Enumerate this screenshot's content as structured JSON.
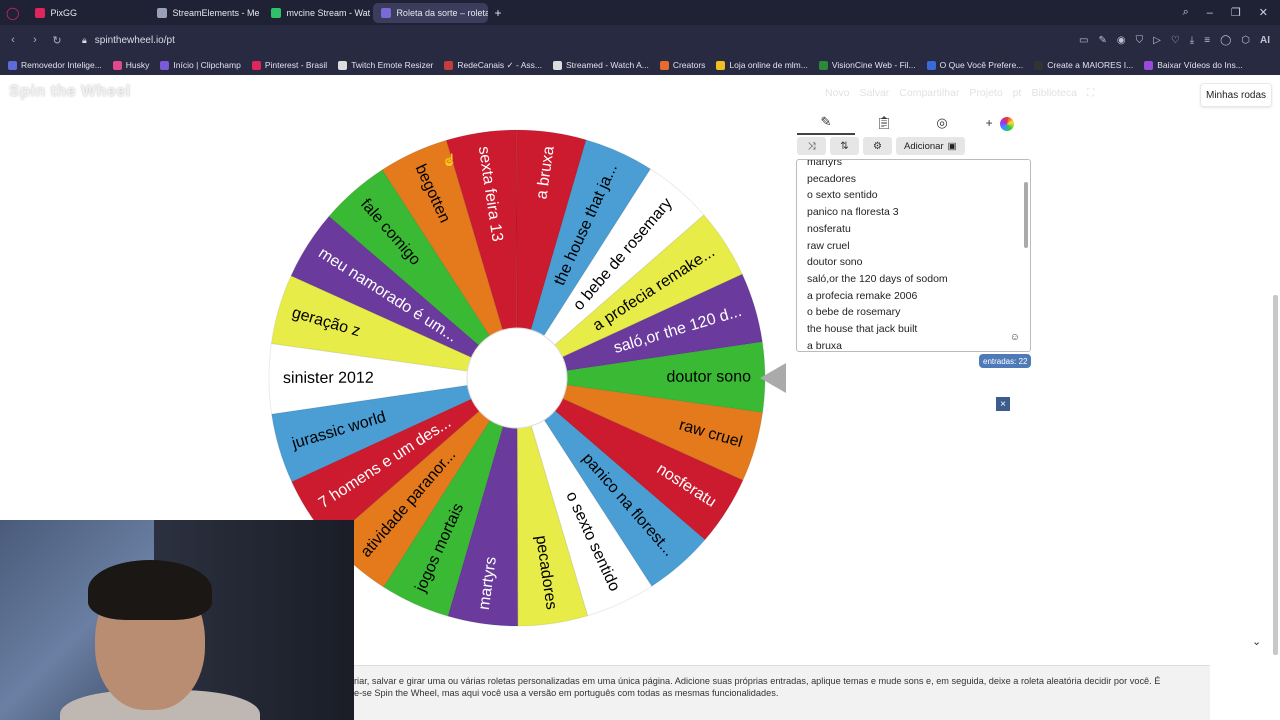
{
  "browser": {
    "tabs": [
      {
        "label": "PixGG",
        "color": "#e0245e",
        "active": false
      },
      {
        "label": "StreamElements - Me",
        "color": "#9aa0b8",
        "active": false
      },
      {
        "label": "mvcine Stream - Wat",
        "color": "#2fc26a",
        "active": false
      },
      {
        "label": "Roleta da sorte – roleta c",
        "color": "#7a6ad8",
        "active": true
      }
    ],
    "new_tab": "+",
    "url": "spinthewheel.io/pt",
    "bookmarks": [
      {
        "label": "Removedor Intelige...",
        "color": "#5b6bd8"
      },
      {
        "label": "Husky",
        "color": "#e04a8a"
      },
      {
        "label": "Início | Clipchamp",
        "color": "#7a5ad8"
      },
      {
        "label": "Pinterest - Brasil",
        "color": "#e0245e"
      },
      {
        "label": "Twitch Emote Resizer",
        "color": "#dddddd"
      },
      {
        "label": "RedeCanais ✓ - Ass...",
        "color": "#c43d3d"
      },
      {
        "label": "Streamed - Watch A...",
        "color": "#dddddd"
      },
      {
        "label": "Creators",
        "color": "#e86a2c"
      },
      {
        "label": "Loja online de mlm...",
        "color": "#f0c020"
      },
      {
        "label": "VisionCine Web - Fil...",
        "color": "#2a8a3a"
      },
      {
        "label": "O Que Você Prefere...",
        "color": "#3a6ad8"
      },
      {
        "label": "Create a MAIORES I...",
        "color": "#333333"
      },
      {
        "label": "Baixar Vídeos do Ins...",
        "color": "#9a4ad8"
      }
    ]
  },
  "app": {
    "logo": "Spin the Wheel",
    "menu": [
      "Novo",
      "Salvar",
      "Compartilhar",
      "Projeto",
      "pt",
      "Biblioteca"
    ],
    "my_wheels": "Minhas rodas",
    "add_label": "Adicionar",
    "entries_visible": [
      "martyrs",
      "pecadores",
      "o sexto sentido",
      "panico na floresta 3",
      "nosferatu",
      "raw cruel",
      "doutor sono",
      "saló,or the 120 days of sodom",
      "a profecia remake 2006",
      "o bebe de rosemary",
      "the house that jack built",
      "a bruxa"
    ],
    "entries_count": "entradas: 22",
    "close": "×"
  },
  "wheel": {
    "segments": [
      {
        "label": "a bruxa",
        "color": "#cc1a2e",
        "text": "#ffffff"
      },
      {
        "label": "the house that ja...",
        "color": "#4a9ed4",
        "text": "#000000"
      },
      {
        "label": "o bebe de rosemary",
        "color": "#ffffff",
        "text": "#000000"
      },
      {
        "label": "a profecia remake...",
        "color": "#e8ec48",
        "text": "#000000"
      },
      {
        "label": "saló,or the 120 d...",
        "color": "#6a3a9c",
        "text": "#ffffff"
      },
      {
        "label": "doutor sono",
        "color": "#3aba34",
        "text": "#000000"
      },
      {
        "label": "raw cruel",
        "color": "#e47a1c",
        "text": "#000000"
      },
      {
        "label": "nosferatu",
        "color": "#cc1a2e",
        "text": "#ffffff"
      },
      {
        "label": "panico na florest...",
        "color": "#4a9ed4",
        "text": "#000000"
      },
      {
        "label": "o sexto sentido",
        "color": "#ffffff",
        "text": "#000000"
      },
      {
        "label": "pecadores",
        "color": "#e8ec48",
        "text": "#000000"
      },
      {
        "label": "martyrs",
        "color": "#6a3a9c",
        "text": "#ffffff"
      },
      {
        "label": "jogos mortais",
        "color": "#3aba34",
        "text": "#000000"
      },
      {
        "label": "atividade paranor...",
        "color": "#e47a1c",
        "text": "#000000"
      },
      {
        "label": "7 homens e um des...",
        "color": "#cc1a2e",
        "text": "#ffffff"
      },
      {
        "label": "jurassic world",
        "color": "#4a9ed4",
        "text": "#000000"
      },
      {
        "label": "sinister 2012",
        "color": "#ffffff",
        "text": "#000000"
      },
      {
        "label": "geração z",
        "color": "#e8ec48",
        "text": "#000000"
      },
      {
        "label": "meu namorado é um...",
        "color": "#6a3a9c",
        "text": "#ffffff"
      },
      {
        "label": "fale comigo",
        "color": "#3aba34",
        "text": "#000000"
      },
      {
        "label": "begotten",
        "color": "#e47a1c",
        "text": "#000000"
      },
      {
        "label": "sexta feira 13",
        "color": "#cc1a2e",
        "text": "#ffffff"
      }
    ]
  },
  "footer": {
    "line1": "riar, salvar e girar uma ou várias roletas personalizadas em uma única página. Adicione suas próprias entradas, aplique temas e mude sons e, em seguida, deixe a roleta aleatória decidir por você. É",
    "line2": "e-se Spin the Wheel, mas aqui você usa a versão em português com todas as mesmas funcionalidades."
  }
}
